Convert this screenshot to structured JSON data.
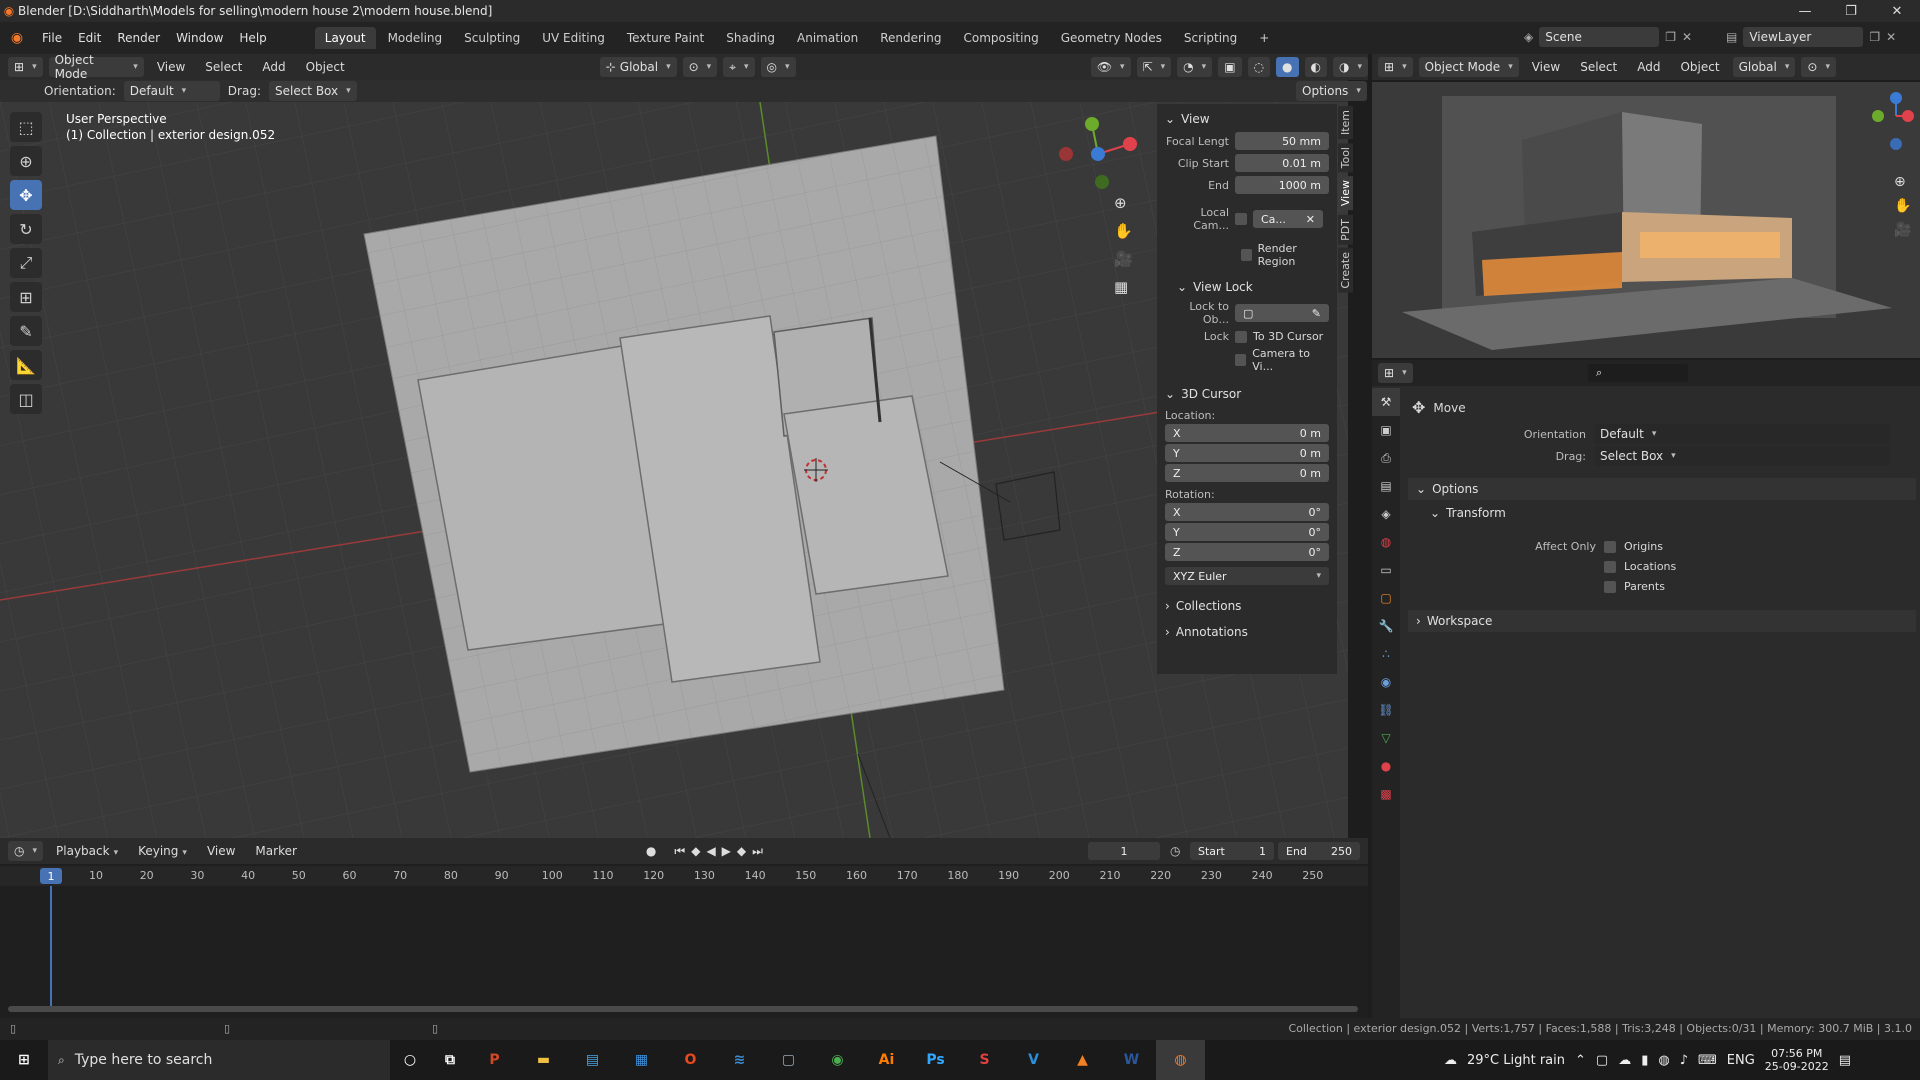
{
  "titlebar": {
    "title": "Blender [D:\\Siddharth\\Models for selling\\modern house 2\\modern house.blend]"
  },
  "menu": [
    "File",
    "Edit",
    "Render",
    "Window",
    "Help"
  ],
  "workspaces": [
    "Layout",
    "Modeling",
    "Sculpting",
    "UV Editing",
    "Texture Paint",
    "Shading",
    "Animation",
    "Rendering",
    "Compositing",
    "Geometry Nodes",
    "Scripting",
    "+"
  ],
  "scene": {
    "label": "Scene",
    "viewlayer": "ViewLayer"
  },
  "viewport_header": {
    "mode": "Object Mode",
    "menus": [
      "View",
      "Select",
      "Add",
      "Object"
    ],
    "transform": "Global"
  },
  "tool_settings": {
    "orientation_label": "Orientation:",
    "orientation_value": "Default",
    "drag_label": "Drag:",
    "drag_value": "Select Box",
    "options": "Options"
  },
  "viewport_overlay": {
    "perspective": "User Perspective",
    "collection": "(1) Collection | exterior design.052"
  },
  "npanel": {
    "view_header": "View",
    "focal_label": "Focal Lengt",
    "focal_value": "50 mm",
    "clip_start_label": "Clip Start",
    "clip_start_value": "0.01 m",
    "clip_end_label": "End",
    "clip_end_value": "1000 m",
    "local_cam_label": "Local Cam...",
    "local_cam_value": "Ca...",
    "render_region": "Render Region",
    "view_lock_header": "View Lock",
    "lock_obj_label": "Lock to Ob...",
    "lock_label": "Lock",
    "to_cursor": "To 3D Cursor",
    "camera_to_view": "Camera to Vi...",
    "cursor_header": "3D Cursor",
    "location_label": "Location:",
    "rotation_label": "Rotation:",
    "loc": [
      {
        "axis": "X",
        "value": "0 m"
      },
      {
        "axis": "Y",
        "value": "0 m"
      },
      {
        "axis": "Z",
        "value": "0 m"
      }
    ],
    "rot": [
      {
        "axis": "X",
        "value": "0°"
      },
      {
        "axis": "Y",
        "value": "0°"
      },
      {
        "axis": "Z",
        "value": "0°"
      }
    ],
    "euler": "XYZ Euler",
    "collections": "Collections",
    "annotations": "Annotations"
  },
  "vtabs": [
    "Item",
    "Tool",
    "View",
    "PDT",
    "Create"
  ],
  "preview_header": {
    "mode": "Object Mode",
    "menus": [
      "View",
      "Select",
      "Add",
      "Object"
    ],
    "transform": "Global"
  },
  "properties": {
    "tool_name": "Move",
    "orientation_label": "Orientation",
    "orientation_value": "Default",
    "drag_label": "Drag:",
    "drag_value": "Select Box",
    "options_header": "Options",
    "transform_header": "Transform",
    "affect_only_label": "Affect Only",
    "origins": "Origins",
    "locations": "Locations",
    "parents": "Parents",
    "workspace_header": "Workspace"
  },
  "timeline": {
    "menus": [
      "Playback",
      "Keying",
      "View",
      "Marker"
    ],
    "current_frame": "1",
    "start_label": "Start",
    "start_value": "1",
    "end_label": "End",
    "end_value": "250",
    "ticks": [
      "10",
      "20",
      "30",
      "40",
      "50",
      "60",
      "70",
      "80",
      "90",
      "100",
      "110",
      "120",
      "130",
      "140",
      "150",
      "160",
      "170",
      "180",
      "190",
      "200",
      "210",
      "220",
      "230",
      "240",
      "250"
    ],
    "frame_marker": "1"
  },
  "statusbar": {
    "text": "Collection | exterior design.052 | Verts:1,757 | Faces:1,588 | Tris:3,248 | Objects:0/31 | Memory: 300.7 MiB | 3.1.0"
  },
  "taskbar": {
    "search_placeholder": "Type here to search",
    "weather": "29°C  Light rain",
    "lang": "ENG",
    "time": "07:56 PM",
    "date": "25-09-2022",
    "apps": [
      {
        "name": "P",
        "color": "#d24726"
      },
      {
        "name": "▬",
        "color": "#f0c040"
      },
      {
        "name": "▤",
        "color": "#4aa3df"
      },
      {
        "name": "▦",
        "color": "#3b8fd9"
      },
      {
        "name": "O",
        "color": "#e8481f"
      },
      {
        "name": "≋",
        "color": "#3c8cd6"
      },
      {
        "name": "▢",
        "color": "#9aa5b1"
      },
      {
        "name": "◉",
        "color": "#4caf50"
      },
      {
        "name": "Ai",
        "color": "#ff7c00"
      },
      {
        "name": "Ps",
        "color": "#31a8ff"
      },
      {
        "name": "S",
        "color": "#e04040"
      },
      {
        "name": "V",
        "color": "#2b8fd9"
      },
      {
        "name": "▲",
        "color": "#f48021"
      },
      {
        "name": "W",
        "color": "#2b579a"
      },
      {
        "name": "◍",
        "color": "#f5792a"
      }
    ]
  }
}
